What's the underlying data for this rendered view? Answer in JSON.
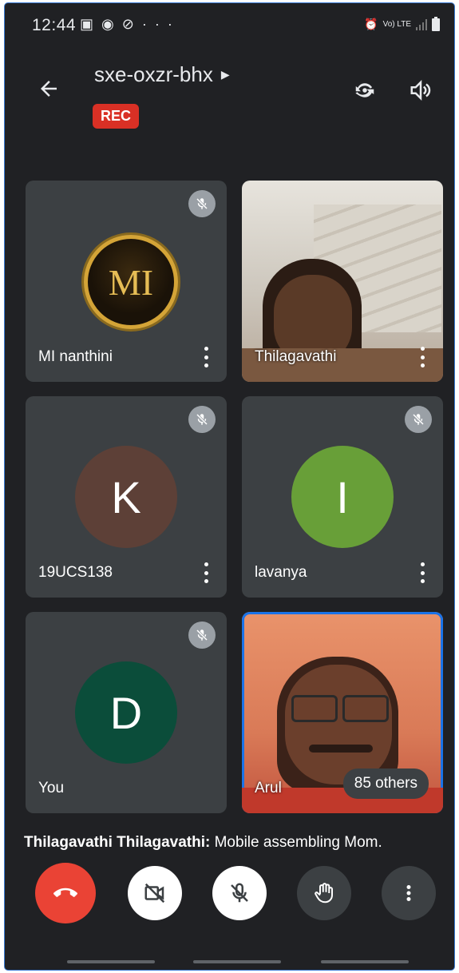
{
  "status_bar": {
    "time": "12:44",
    "left_icons": [
      "image-icon",
      "chrome-icon",
      "blocked-icon",
      "more-dots-icon"
    ],
    "network": "Vo) LTE",
    "network_sub": "LTE2"
  },
  "header": {
    "meeting_code": "sxe-oxzr-bhx",
    "rec_label": "REC",
    "icons": [
      "back-arrow-icon",
      "switch-camera-icon",
      "speaker-icon"
    ]
  },
  "participants": [
    {
      "name": "MI nanthini",
      "type": "logo",
      "logo_text": "MI",
      "muted": true
    },
    {
      "name": "Thilagavathi",
      "type": "video",
      "muted": false
    },
    {
      "name": "19UCS138",
      "type": "initial",
      "initial": "K",
      "color": "#5d4037",
      "muted": true
    },
    {
      "name": "lavanya",
      "type": "initial",
      "initial": "I",
      "color": "#689f38",
      "muted": true
    },
    {
      "name": "You",
      "type": "initial",
      "initial": "D",
      "color": "#0b4d3a",
      "muted": true
    },
    {
      "name": "Arul",
      "type": "video",
      "muted": false,
      "others_label": "85 others"
    }
  ],
  "caption": {
    "speaker": "Thilagavathi Thilagavathi:",
    "text": " Mobile assembling Mom."
  },
  "controls": [
    {
      "name": "end-call",
      "color": "#ea4335"
    },
    {
      "name": "camera-off",
      "color": "#ffffff"
    },
    {
      "name": "mic-off",
      "color": "#ffffff"
    },
    {
      "name": "raise-hand",
      "color": "#3c4043"
    },
    {
      "name": "more-options",
      "color": "#3c4043"
    }
  ]
}
